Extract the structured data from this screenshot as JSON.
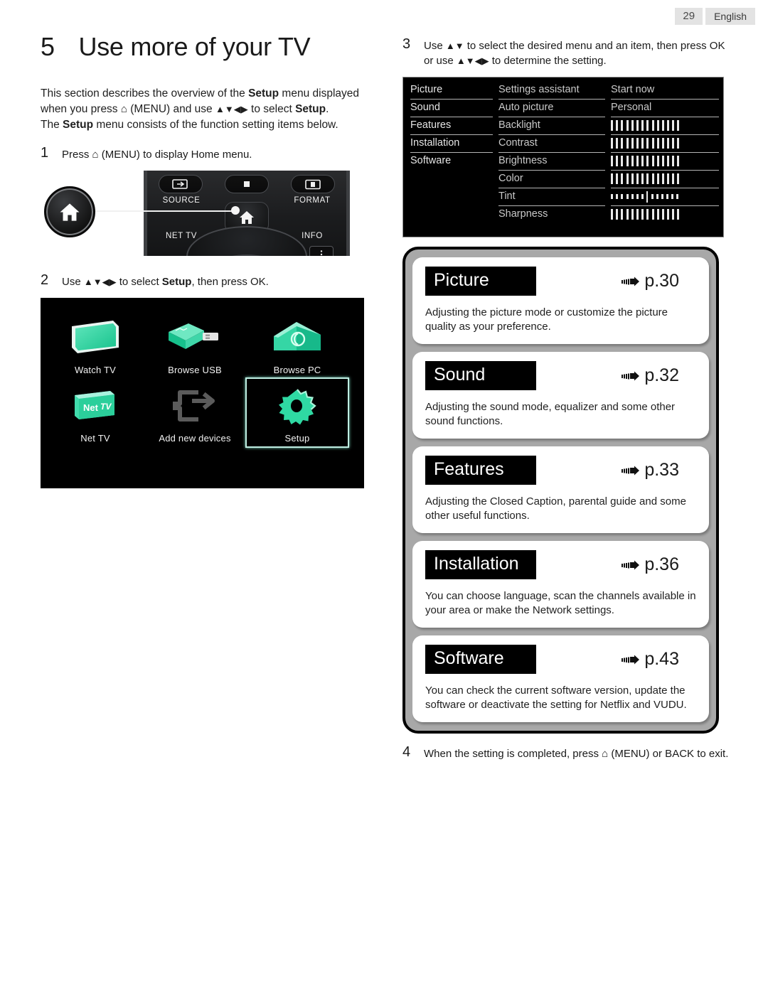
{
  "header": {
    "page_number": "29",
    "language": "English"
  },
  "chapter": {
    "number": "5",
    "title": "Use more of your TV"
  },
  "intro": {
    "line1_a": "This section describes the overview of the ",
    "line1_b": "Setup",
    "line1_c": " menu displayed when you press ",
    "line1_d": " (MENU) and use ",
    "line1_e": " to select ",
    "line1_f": "Setup",
    "line1_g": ".",
    "line2_a": "The ",
    "line2_b": "Setup",
    "line2_c": " menu consists of the function setting items below."
  },
  "steps": {
    "one": {
      "num": "1",
      "text_a": "Press ",
      "text_b": " (MENU) to display Home menu."
    },
    "two": {
      "num": "2",
      "text_a": "Use ",
      "text_b": " to select ",
      "text_c": "Setup",
      "text_d": ", then press OK."
    },
    "three": {
      "num": "3",
      "text_a": "Use ",
      "text_b": " to select the desired menu and an item, then press OK",
      "text_c": "or use ",
      "text_d": " to determine the setting."
    },
    "four": {
      "num": "4",
      "text_a": "When the setting is completed, press ",
      "text_b": " (MENU) or BACK to exit."
    }
  },
  "remote": {
    "source_label": "SOURCE",
    "stop_label": "",
    "format_label": "FORMAT",
    "nettv_label": "NET TV",
    "info_label": "INFO",
    "home_icon": "home-icon",
    "source_icon": "source-input-icon",
    "stop_icon": "stop-square-icon",
    "format_icon": "format-screen-icon"
  },
  "home_menu": {
    "tiles": [
      {
        "label": "Watch TV",
        "icon": "tv-screen-icon",
        "selected": false
      },
      {
        "label": "Browse USB",
        "icon": "usb-stick-icon",
        "selected": false
      },
      {
        "label": "Browse PC",
        "icon": "house-network-icon",
        "selected": false
      },
      {
        "label": "Net TV",
        "icon": "net-tv-icon",
        "selected": false
      },
      {
        "label": "Add new devices",
        "icon": "add-device-arrow-icon",
        "selected": false
      },
      {
        "label": "Setup",
        "icon": "gear-icon",
        "selected": true
      }
    ],
    "accent_color": "#2ed8a5",
    "highlight_color": "#bfeee2"
  },
  "settings_screen": {
    "menu_column": [
      "Picture",
      "Sound",
      "Features",
      "Installation",
      "Software"
    ],
    "items_column": [
      "Settings assistant",
      "Auto picture",
      "Backlight",
      "Contrast",
      "Brightness",
      "Color",
      "Tint",
      "Sharpness"
    ],
    "values_column": [
      {
        "type": "text",
        "value": "Start now"
      },
      {
        "type": "text",
        "value": "Personal"
      },
      {
        "type": "slider",
        "style": "full",
        "bars": 14
      },
      {
        "type": "slider",
        "style": "full",
        "bars": 14
      },
      {
        "type": "slider",
        "style": "full",
        "bars": 14
      },
      {
        "type": "slider",
        "style": "full",
        "bars": 14
      },
      {
        "type": "slider",
        "style": "center",
        "bars": 14
      },
      {
        "type": "slider",
        "style": "full",
        "bars": 14
      }
    ]
  },
  "menu_cards": [
    {
      "title": "Picture",
      "page_ref": "p.30",
      "description": "Adjusting the picture mode or customize the picture quality as your preference."
    },
    {
      "title": "Sound",
      "page_ref": "p.32",
      "description": "Adjusting the sound mode, equalizer and some other sound functions."
    },
    {
      "title": "Features",
      "page_ref": "p.33",
      "description": "Adjusting the Closed Caption, parental guide and some other useful functions."
    },
    {
      "title": "Installation",
      "page_ref": "p.36",
      "description": "You can choose language, scan the channels available in your area or make the Network settings."
    },
    {
      "title": "Software",
      "page_ref": "p.43",
      "description": "You can check the current software version, update the software or deactivate the setting for Netflix and VUDU."
    }
  ]
}
